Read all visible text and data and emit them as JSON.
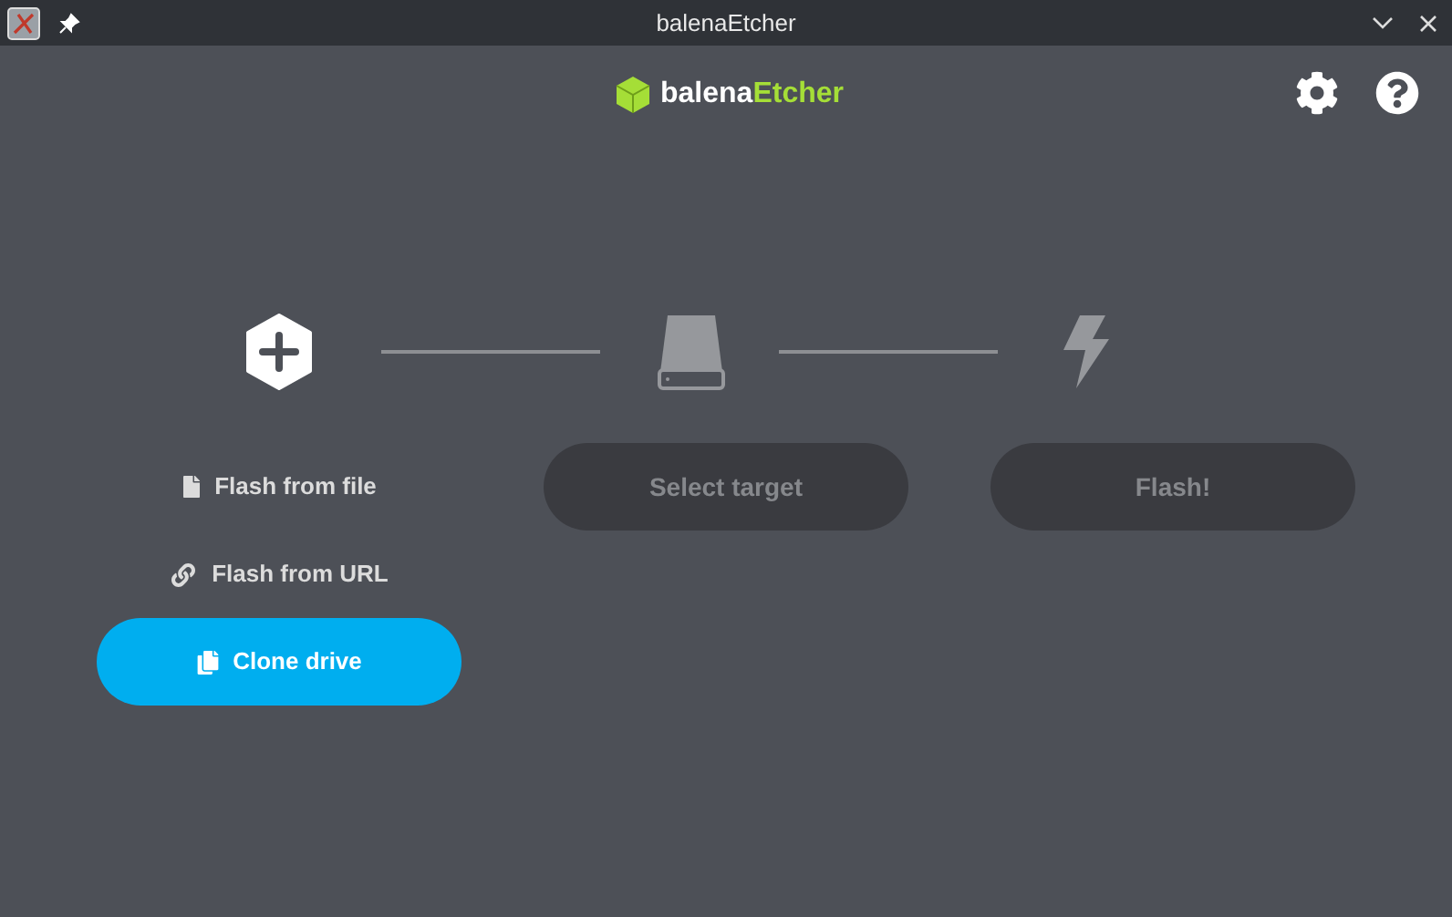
{
  "window": {
    "title": "balenaEtcher"
  },
  "header": {
    "logo_prefix": "balena",
    "logo_suffix": "Etcher"
  },
  "source_options": [
    {
      "label": "Flash from file",
      "kind": "file",
      "primary": false
    },
    {
      "label": "Flash from URL",
      "kind": "url",
      "primary": false
    },
    {
      "label": "Clone drive",
      "kind": "clone",
      "primary": true
    }
  ],
  "target_button": {
    "label": "Select target",
    "disabled": true
  },
  "flash_button": {
    "label": "Flash!",
    "disabled": true
  }
}
